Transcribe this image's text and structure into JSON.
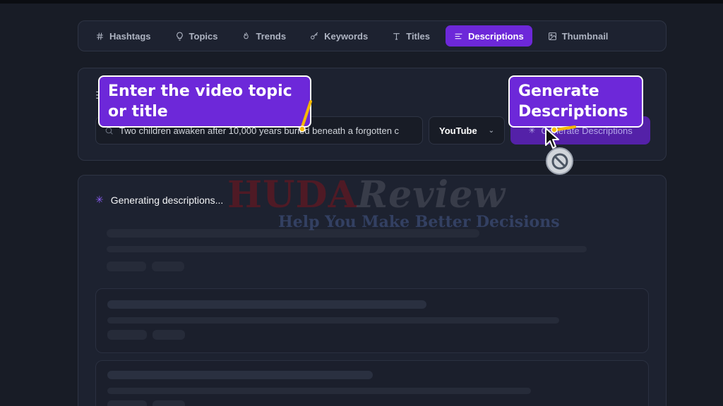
{
  "tabs": [
    {
      "label": "Hashtags",
      "icon": "hash-icon",
      "active": false
    },
    {
      "label": "Topics",
      "icon": "lightbulb-icon",
      "active": false
    },
    {
      "label": "Trends",
      "icon": "flame-icon",
      "active": false
    },
    {
      "label": "Keywords",
      "icon": "key-icon",
      "active": false
    },
    {
      "label": "Titles",
      "icon": "type-icon",
      "active": false
    },
    {
      "label": "Descriptions",
      "icon": "align-left-icon",
      "active": true
    },
    {
      "label": "Thumbnail",
      "icon": "image-icon",
      "active": false
    }
  ],
  "input": {
    "topic_value": "Two children awaken after 10,000 years buried beneath a forgotten c",
    "platform": "YouTube",
    "generate_label": "Generate Descriptions"
  },
  "results": {
    "status": "Generating descriptions..."
  },
  "watermark": {
    "brand_a": "HUDA",
    "brand_b": "Review",
    "tagline": "Help You Make Better Decisions"
  },
  "callouts": {
    "topic": "Enter the video topic or title",
    "generate": "Generate Descriptions"
  },
  "colors": {
    "accent": "#6d28d9",
    "background": "#181c26",
    "card": "#1d2230"
  }
}
